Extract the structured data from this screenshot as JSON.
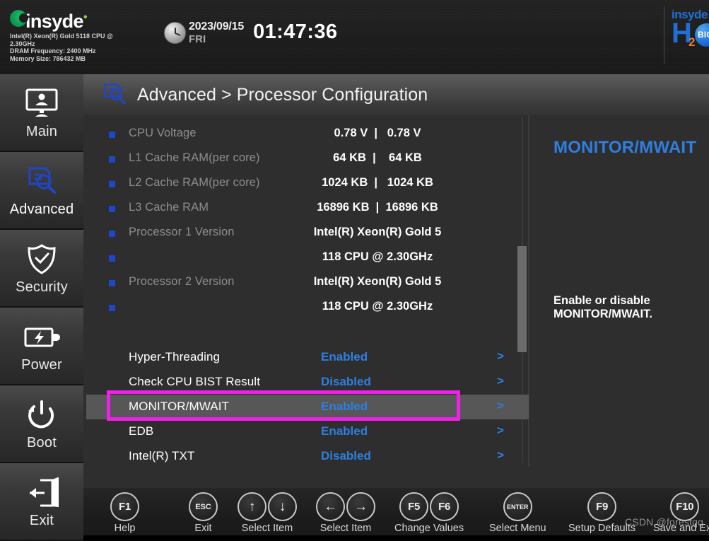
{
  "header": {
    "brand_name": "insyde",
    "brand_star": "•",
    "sysinfo": [
      "Intel(R) Xeon(R) Gold 5118 CPU @",
      "2.30GHz",
      "DRAM Frequency: 2400 MHz",
      "Memory Size: 786432 MB"
    ],
    "clock": {
      "date": "2023/09/15",
      "day": "FRI",
      "time": "01:47:36"
    },
    "logo": {
      "top": "insyde",
      "h": "H",
      "sub": "2",
      "badge": "BIOS"
    }
  },
  "sidebar": {
    "items": [
      {
        "label": "Main",
        "icon": "monitor-user-icon",
        "active": false
      },
      {
        "label": "Advanced",
        "icon": "document-search-icon",
        "active": true
      },
      {
        "label": "Security",
        "icon": "shield-check-icon",
        "active": false
      },
      {
        "label": "Power",
        "icon": "battery-bolt-icon",
        "active": false
      },
      {
        "label": "Boot",
        "icon": "power-icon",
        "active": false
      },
      {
        "label": "Exit",
        "icon": "exit-door-icon",
        "active": false
      }
    ]
  },
  "page": {
    "title": "Advanced > Processor Configuration",
    "title_icon": "document-search-icon"
  },
  "info_rows": [
    {
      "label": "CPU Voltage",
      "value": "0.78 V  |   0.78 V"
    },
    {
      "label": "L1 Cache RAM(per core)",
      "value": "64 KB  |    64 KB"
    },
    {
      "label": "L2 Cache RAM(per core)",
      "value": "1024 KB  |   1024 KB"
    },
    {
      "label": "L3 Cache RAM",
      "value": "16896 KB  |  16896 KB"
    },
    {
      "label": "Processor 1 Version",
      "value": "Intel(R) Xeon(R) Gold 5"
    },
    {
      "label": "",
      "value": "118 CPU @ 2.30GHz"
    },
    {
      "label": "Processor 2 Version",
      "value": "Intel(R) Xeon(R) Gold 5"
    },
    {
      "label": "",
      "value": "118 CPU @ 2.30GHz"
    }
  ],
  "option_rows": [
    {
      "label": "Hyper-Threading",
      "value": "Enabled",
      "arrow": ">",
      "selected": false
    },
    {
      "label": "Check CPU BIST Result",
      "value": "Disabled",
      "arrow": ">",
      "selected": false
    },
    {
      "label": "MONITOR/MWAIT",
      "value": "Enabled",
      "arrow": ">",
      "selected": true
    },
    {
      "label": "EDB",
      "value": "Enabled",
      "arrow": ">",
      "selected": false
    },
    {
      "label": "Intel(R) TXT",
      "value": "Disabled",
      "arrow": ">",
      "selected": false
    }
  ],
  "help": {
    "title": "MONITOR/MWAIT",
    "icon": "document-search-icon",
    "text": "Enable or disable\nMONITOR/MWAIT."
  },
  "footer": {
    "keys": [
      {
        "keys": [
          "F1"
        ],
        "caption": "Help",
        "style": "normal"
      },
      {
        "keys": [
          "ESC"
        ],
        "caption": "Exit",
        "style": "small"
      },
      {
        "keys": [
          "↑",
          "↓"
        ],
        "caption": "Select Item",
        "style": "arrow"
      },
      {
        "keys": [
          "←",
          "→"
        ],
        "caption": "Select Item",
        "style": "arrow"
      },
      {
        "keys": [
          "F5",
          "F6"
        ],
        "caption": "Change Values",
        "style": "normal"
      },
      {
        "keys": [
          "ENTER"
        ],
        "caption": "Select Menu",
        "style": "small"
      },
      {
        "keys": [
          "F9"
        ],
        "caption": "Setup Defaults",
        "style": "normal"
      },
      {
        "keys": [
          "F10"
        ],
        "caption": "Save and Exit",
        "style": "normal"
      }
    ]
  },
  "watermark": "CSDN @forestqq",
  "colors": {
    "accent_blue": "#2e7fe0",
    "bullet_blue": "#1f46c8",
    "highlight_magenta": "#f020e8",
    "panel_bg": "#2e2e2e"
  }
}
